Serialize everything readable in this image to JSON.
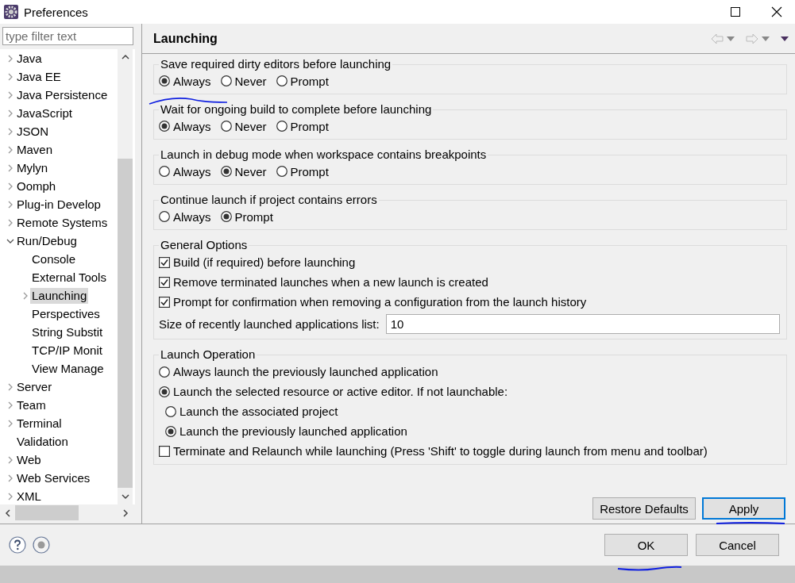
{
  "window": {
    "title": "Preferences"
  },
  "filter": {
    "placeholder": "type filter text"
  },
  "tree": [
    {
      "label": "Java",
      "expandable": true,
      "expanded": false,
      "selected": false
    },
    {
      "label": "Java EE",
      "expandable": true,
      "expanded": false,
      "selected": false
    },
    {
      "label": "Java Persistence",
      "expandable": true,
      "expanded": false,
      "selected": false
    },
    {
      "label": "JavaScript",
      "expandable": true,
      "expanded": false,
      "selected": false
    },
    {
      "label": "JSON",
      "expandable": true,
      "expanded": false,
      "selected": false
    },
    {
      "label": "Maven",
      "expandable": true,
      "expanded": false,
      "selected": false
    },
    {
      "label": "Mylyn",
      "expandable": true,
      "expanded": false,
      "selected": false
    },
    {
      "label": "Oomph",
      "expandable": true,
      "expanded": false,
      "selected": false
    },
    {
      "label": "Plug-in Develop",
      "expandable": true,
      "expanded": false,
      "selected": false
    },
    {
      "label": "Remote Systems",
      "expandable": true,
      "expanded": false,
      "selected": false
    },
    {
      "label": "Run/Debug",
      "expandable": true,
      "expanded": true,
      "selected": false,
      "children": [
        {
          "label": "Console",
          "expandable": false,
          "selected": false
        },
        {
          "label": "External Tools",
          "expandable": false,
          "selected": false
        },
        {
          "label": "Launching",
          "expandable": true,
          "expanded": false,
          "selected": true
        },
        {
          "label": "Perspectives",
          "expandable": false,
          "selected": false
        },
        {
          "label": "String Substit",
          "expandable": false,
          "selected": false
        },
        {
          "label": "TCP/IP Monit",
          "expandable": false,
          "selected": false
        },
        {
          "label": "View Manage",
          "expandable": false,
          "selected": false
        }
      ]
    },
    {
      "label": "Server",
      "expandable": true,
      "expanded": false,
      "selected": false
    },
    {
      "label": "Team",
      "expandable": true,
      "expanded": false,
      "selected": false
    },
    {
      "label": "Terminal",
      "expandable": true,
      "expanded": false,
      "selected": false
    },
    {
      "label": "Validation",
      "expandable": false,
      "selected": false
    },
    {
      "label": "Web",
      "expandable": true,
      "expanded": false,
      "selected": false
    },
    {
      "label": "Web Services",
      "expandable": true,
      "expanded": false,
      "selected": false
    },
    {
      "label": "XML",
      "expandable": true,
      "expanded": false,
      "selected": false
    }
  ],
  "page": {
    "title": "Launching"
  },
  "groups": [
    {
      "kind": "radio_group",
      "title": "Save required dirty editors before launching",
      "options": [
        {
          "label": "Always",
          "selected": true
        },
        {
          "label": "Never",
          "selected": false
        },
        {
          "label": "Prompt",
          "selected": false
        }
      ]
    },
    {
      "kind": "radio_group",
      "title": "Wait for ongoing build to complete before launching",
      "options": [
        {
          "label": "Always",
          "selected": true
        },
        {
          "label": "Never",
          "selected": false
        },
        {
          "label": "Prompt",
          "selected": false
        }
      ]
    },
    {
      "kind": "radio_group",
      "title": "Launch in debug mode when workspace contains breakpoints",
      "options": [
        {
          "label": "Always",
          "selected": false
        },
        {
          "label": "Never",
          "selected": true
        },
        {
          "label": "Prompt",
          "selected": false
        }
      ]
    },
    {
      "kind": "radio_group",
      "title": "Continue launch if project contains errors",
      "options": [
        {
          "label": "Always",
          "selected": false
        },
        {
          "label": "Prompt",
          "selected": true
        }
      ]
    },
    {
      "kind": "options",
      "title": "General Options",
      "items": [
        {
          "kind": "checkbox",
          "label": "Build (if required) before launching",
          "checked": true
        },
        {
          "kind": "checkbox",
          "label": "Remove terminated launches when a new launch is created",
          "checked": true
        },
        {
          "kind": "checkbox",
          "label": "Prompt for confirmation when removing a configuration from the launch history",
          "checked": true
        },
        {
          "kind": "field",
          "label": "Size of recently launched applications list:",
          "value": "10"
        }
      ]
    },
    {
      "kind": "options",
      "title": "Launch Operation",
      "items": [
        {
          "kind": "radio",
          "label": "Always launch the previously launched application",
          "selected": false
        },
        {
          "kind": "radio",
          "label": "Launch the selected resource or active editor. If not launchable:",
          "selected": true,
          "children": [
            {
              "kind": "radio",
              "label": "Launch the associated project",
              "selected": false
            },
            {
              "kind": "radio",
              "label": "Launch the previously launched application",
              "selected": true
            }
          ]
        },
        {
          "kind": "checkbox",
          "label": "Terminate and Relaunch while launching (Press 'Shift' to toggle during launch from menu and toolbar)",
          "checked": false
        }
      ]
    }
  ],
  "page_buttons": [
    {
      "label": "Restore Defaults",
      "focused": false
    },
    {
      "label": "Apply",
      "focused": true
    }
  ],
  "dialog_buttons": [
    {
      "label": "OK",
      "focused": false
    },
    {
      "label": "Cancel",
      "focused": false
    }
  ]
}
